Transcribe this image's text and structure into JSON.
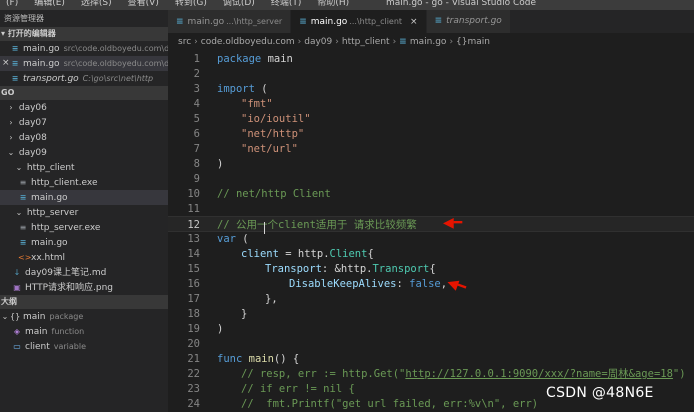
{
  "menu": [
    "(F)",
    "编辑(E)",
    "选择(S)",
    "查看(V)",
    "转到(G)",
    "调试(D)",
    "终端(T)",
    "帮助(H)"
  ],
  "window_title": "main.go - go - Visual Studio Code",
  "sidebar": {
    "header": "资源管理器",
    "open_editors_title": "打开的编辑器",
    "open_editors": [
      {
        "name": "main.go",
        "desc": "src\\code.oldboyedu.com\\da..."
      },
      {
        "name": "main.go",
        "desc": "src\\code.oldboyedu.com\\da..."
      },
      {
        "name": "transport.go",
        "desc": "C:\\go\\src\\net\\http"
      }
    ],
    "workspace_title": "GO",
    "tree": [
      {
        "label": "day06"
      },
      {
        "label": "day07"
      },
      {
        "label": "day08"
      },
      {
        "label": "day09"
      },
      {
        "label": "http_client"
      },
      {
        "label": "http_client.exe"
      },
      {
        "label": "main.go"
      },
      {
        "label": "http_server"
      },
      {
        "label": "http_server.exe"
      },
      {
        "label": "main.go"
      },
      {
        "label": "xx.html"
      },
      {
        "label": "day09课上笔记.md"
      },
      {
        "label": "HTTP请求和响应.png"
      }
    ],
    "outline_title": "大纲",
    "outline": [
      {
        "name": "main",
        "kind": "package"
      },
      {
        "name": "main",
        "kind": "function"
      },
      {
        "name": "client",
        "kind": "variable"
      }
    ]
  },
  "tabs": [
    {
      "name": "main.go",
      "desc": "...\\http_server"
    },
    {
      "name": "main.go",
      "desc": "...\\http_client",
      "close": "×"
    },
    {
      "name": "transport.go"
    }
  ],
  "breadcrumb": [
    "src",
    "code.oldboyedu.com",
    "day09",
    "http_client",
    "main.go",
    "{}main"
  ],
  "editor": {
    "line_numbers": [
      "1",
      "2",
      "3",
      "4",
      "5",
      "6",
      "7",
      "8",
      "9",
      "10",
      "11",
      "12",
      "13",
      "14",
      "15",
      "16",
      "17",
      "18",
      "19",
      "20",
      "21",
      "22",
      "23",
      "24"
    ],
    "l1": {
      "kw": "package",
      "rest": " main"
    },
    "l3": {
      "kw": "import",
      "rest": " ("
    },
    "l4": "\"fmt\"",
    "l5": "\"io/ioutil\"",
    "l6": "\"net/http\"",
    "l7": "\"net/url\"",
    "l8": ")",
    "l10": "// net/http Client",
    "l12": "// 公用一个client适用于 请求比较频繁",
    "l13": {
      "kw": "var",
      "rest": " ("
    },
    "l14": {
      "a": "client",
      "b": " = http.",
      "c": "Client",
      "d": "{"
    },
    "l15": {
      "a": "Transport",
      "b": ": &http.",
      "c": "Transport",
      "d": "{"
    },
    "l16": {
      "a": "DisableKeepAlives",
      "b": ": ",
      "c": "false",
      "d": ","
    },
    "l17": "},",
    "l18": "}",
    "l19": ")",
    "l21": {
      "kw": "func",
      "fn": " main",
      "rest": "() {"
    },
    "l22a": "// resp, err := http.Get(\"",
    "l22b": "http://127.0.0.1:9090/xxx/?name=周林&age=18",
    "l22c": "\")",
    "l23": "// if err != nil {",
    "l24": "//  fmt.Printf(\"get url failed, err:%v\\n\", err)"
  },
  "watermark": "CSDN @48N6E",
  "colors": {
    "accent_arrow": "#e51400",
    "keyword": "#569cd6",
    "string": "#ce9178",
    "comment": "#6a9955"
  }
}
